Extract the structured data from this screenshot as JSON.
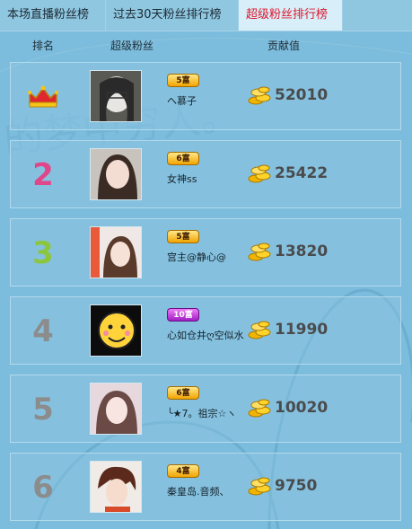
{
  "tabs": [
    {
      "label": "本场直播粉丝榜",
      "active": false
    },
    {
      "label": "过去30天粉丝排行榜",
      "active": false
    },
    {
      "label": "超级粉丝排行榜",
      "active": true
    }
  ],
  "columns": {
    "rank": "排名",
    "fan": "超级粉丝",
    "contribution": "贡献值"
  },
  "watermark": "的梦中穷人。",
  "rows": [
    {
      "rank": "1",
      "level": "5富",
      "name": "ヘ慕子",
      "value": "52010",
      "rank_color": "#c8102e"
    },
    {
      "rank": "2",
      "level": "6富",
      "name": "女神ss",
      "value": "25422",
      "rank_color": "#e0478a"
    },
    {
      "rank": "3",
      "level": "5富",
      "name": "宫主@静心@",
      "value": "13820",
      "rank_color": "#8cc63f"
    },
    {
      "rank": "4",
      "level": "10富",
      "name": "心如仓井ღ空似水",
      "value": "11990",
      "rank_color": "#8c8c8c"
    },
    {
      "rank": "5",
      "level": "6富",
      "name": "╰★7。祖宗☆ヽ",
      "value": "10020",
      "rank_color": "#8c8c8c"
    },
    {
      "rank": "6",
      "level": "4富",
      "name": "秦皇岛.音频、",
      "value": "9750",
      "rank_color": "#8c8c8c"
    }
  ]
}
